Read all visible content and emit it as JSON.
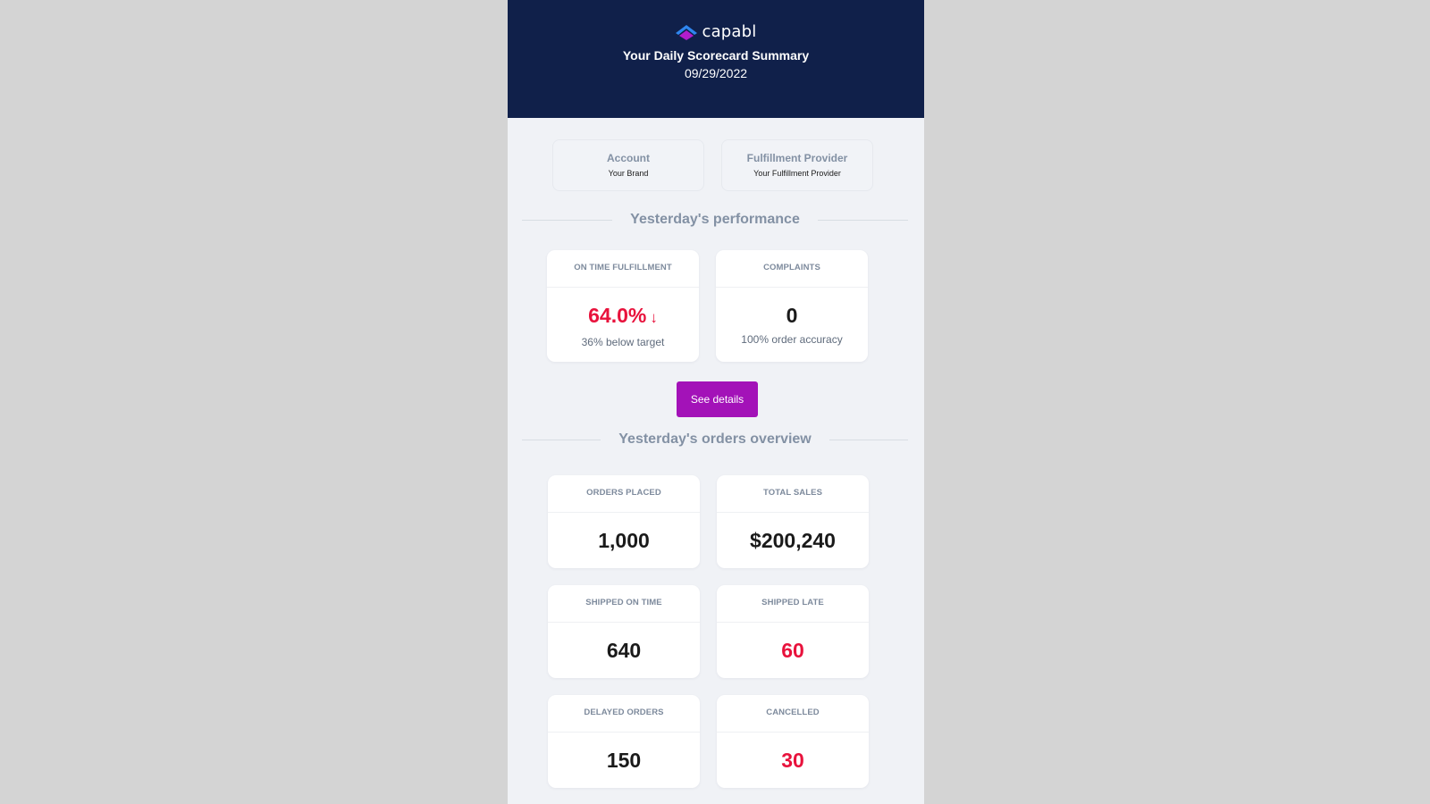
{
  "header": {
    "brand": "capabl",
    "title": "Your Daily Scorecard Summary",
    "date": "09/29/2022",
    "colors": {
      "background": "#10204a",
      "logo_top": "#2f86f0",
      "logo_bottom": "#b21dcc"
    }
  },
  "info": [
    {
      "label": "Account",
      "value": "Your Brand"
    },
    {
      "label": "Fulfillment Provider",
      "value": "Your Fulfillment Provider"
    }
  ],
  "performance": {
    "heading": "Yesterday's performance",
    "cards": [
      {
        "label": "ON TIME FULFILLMENT",
        "value": "64.0%",
        "trend_icon": "arrow-down-icon",
        "trend": "↓",
        "sub": "36% below target",
        "status": "bad"
      },
      {
        "label": "COMPLAINTS",
        "value": "0",
        "sub": "100% order accuracy",
        "status": "neutral"
      }
    ],
    "cta_label": "See details"
  },
  "orders": {
    "heading": "Yesterday's orders overview",
    "cards": [
      {
        "label": "ORDERS PLACED",
        "value": "1,000",
        "status": "neutral"
      },
      {
        "label": "TOTAL SALES",
        "value": "$200,240",
        "status": "neutral"
      },
      {
        "label": "SHIPPED ON TIME",
        "value": "640",
        "status": "neutral"
      },
      {
        "label": "SHIPPED LATE",
        "value": "60",
        "status": "bad"
      },
      {
        "label": "DELAYED ORDERS",
        "value": "150",
        "status": "neutral"
      },
      {
        "label": "CANCELLED",
        "value": "30",
        "status": "bad"
      }
    ]
  },
  "colors": {
    "accent": "#a312b8",
    "negative": "#e8123c",
    "muted": "#8391a4"
  }
}
